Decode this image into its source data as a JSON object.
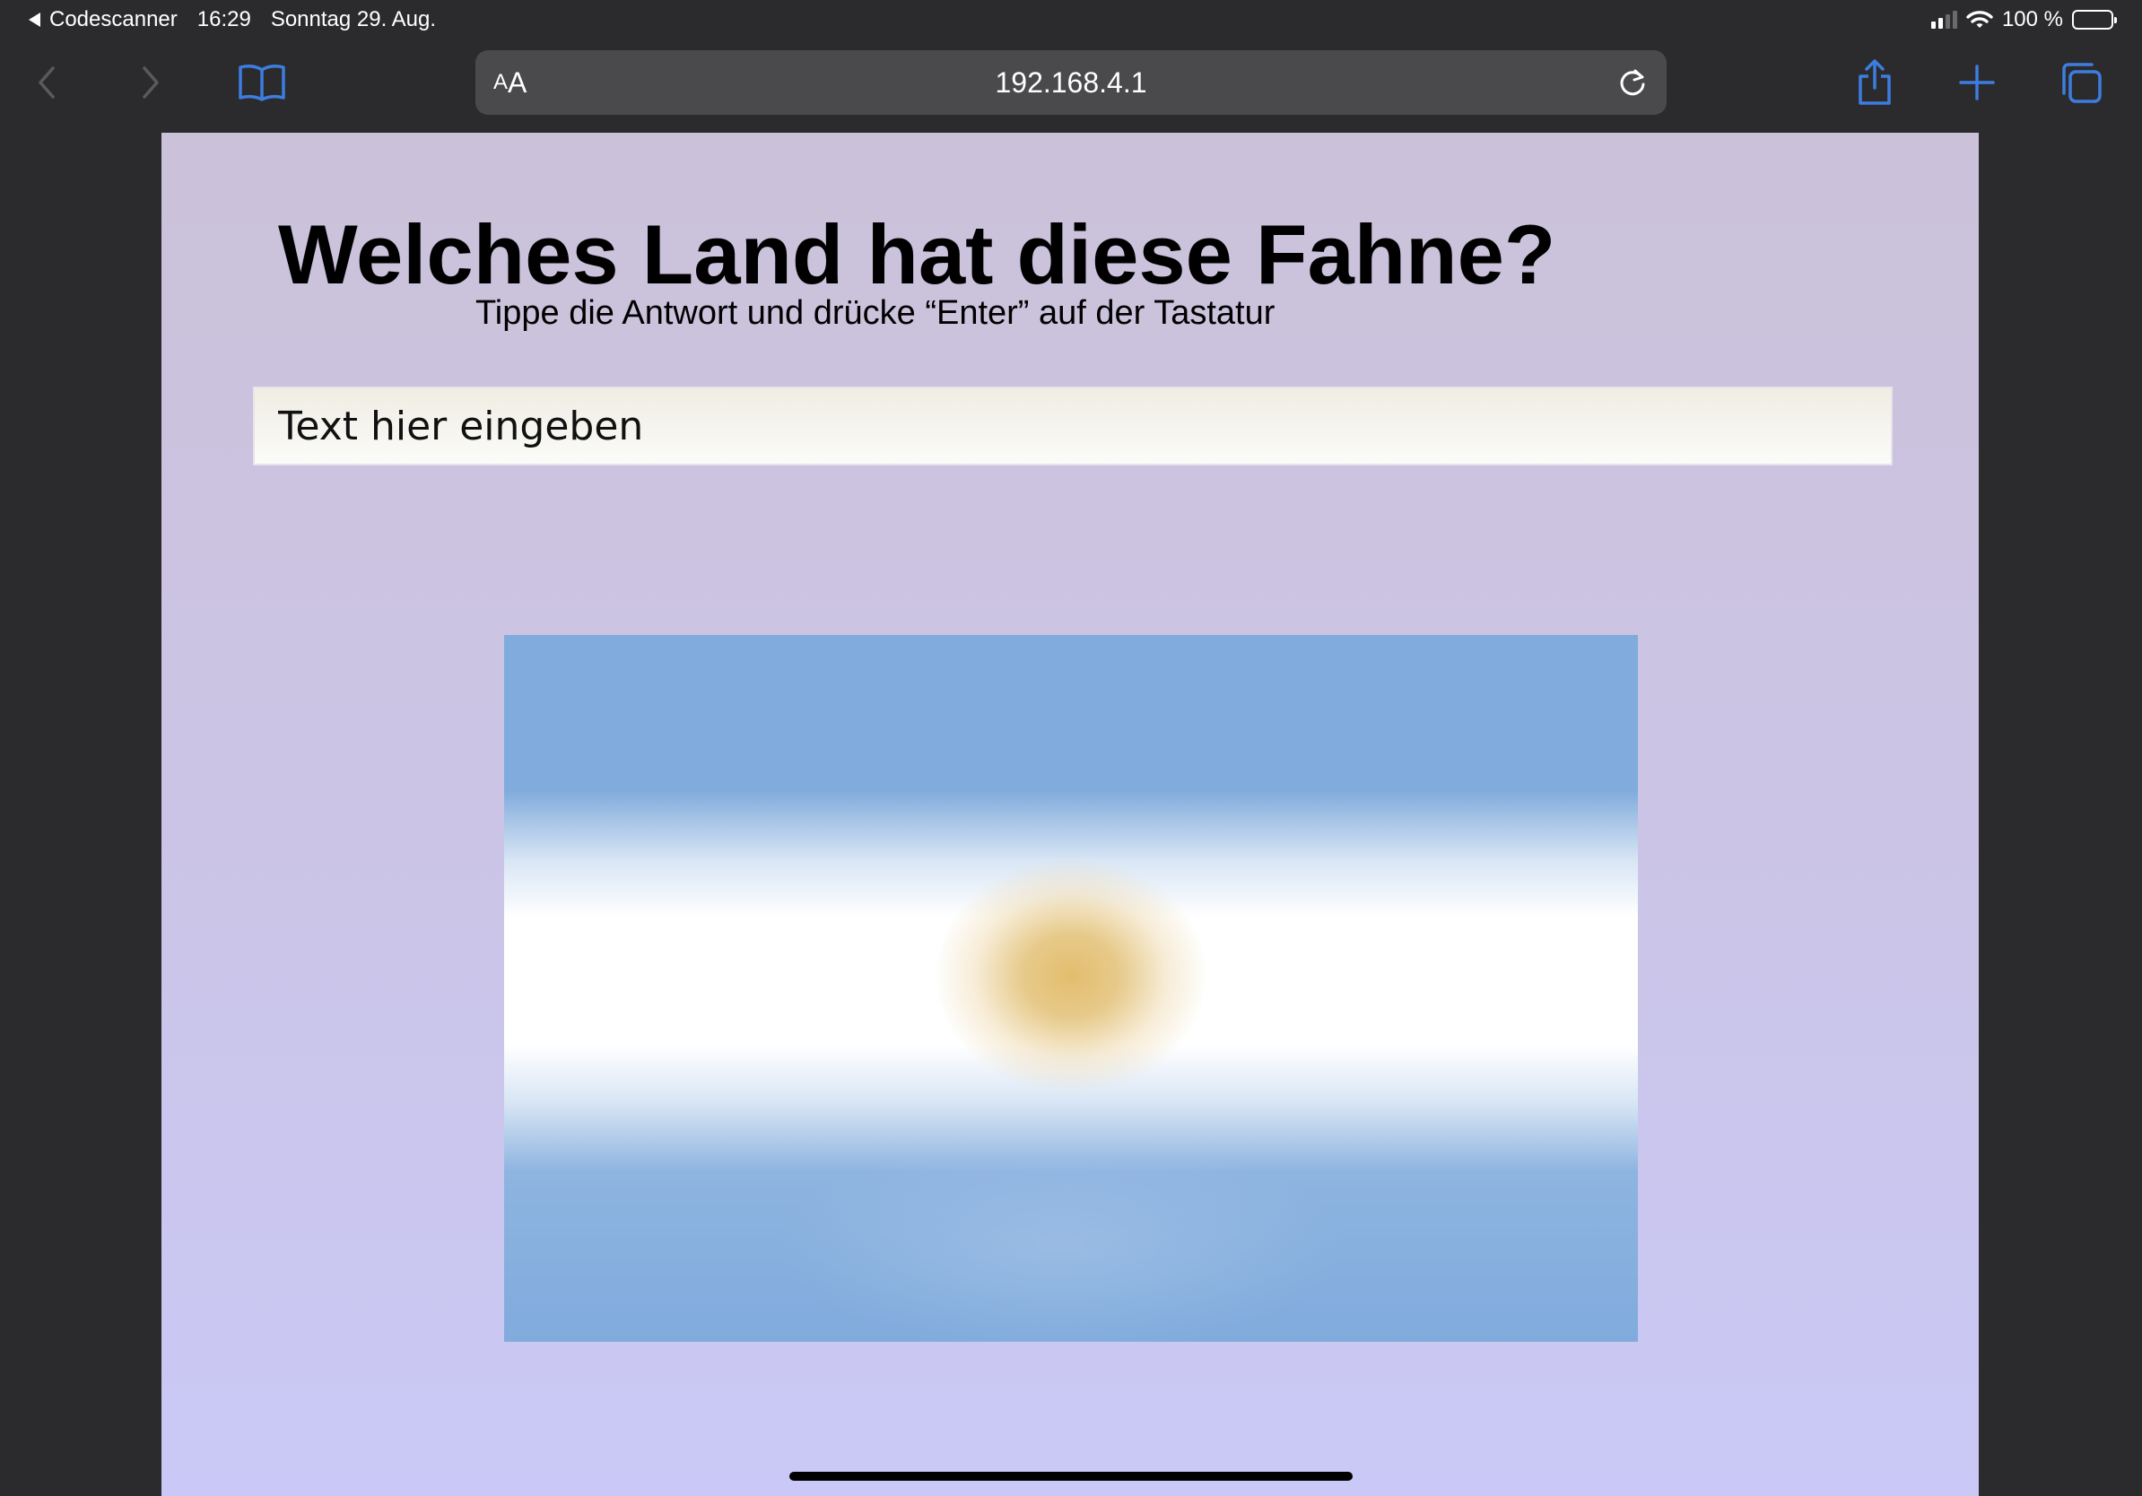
{
  "status_bar": {
    "back_app": "Codescanner",
    "time": "16:29",
    "date": "Sonntag 29. Aug.",
    "battery": "100 %"
  },
  "toolbar": {
    "text_size_small": "A",
    "text_size_large": "A",
    "url": "192.168.4.1",
    "icons": [
      "chevron-left-icon",
      "chevron-right-icon",
      "book-icon",
      "reload-icon",
      "share-icon",
      "plus-icon",
      "tabs-icon"
    ]
  },
  "page": {
    "title": "Welches Land hat diese Fahne?",
    "subtitle": "Tippe die Antwort und drücke “Enter” auf der Tastatur",
    "input": {
      "placeholder": "Text hier eingeben",
      "value": ""
    }
  },
  "colors": {
    "chrome_background": "#2b2b2d",
    "address_bar": "#4a4a4c",
    "accent": "#3d7de0",
    "page_gradient_top": "#cbc1d9",
    "page_gradient_bottom": "#cac8f6",
    "flag_blue": "#80abdc",
    "flag_sun": "#e2bd6e"
  }
}
